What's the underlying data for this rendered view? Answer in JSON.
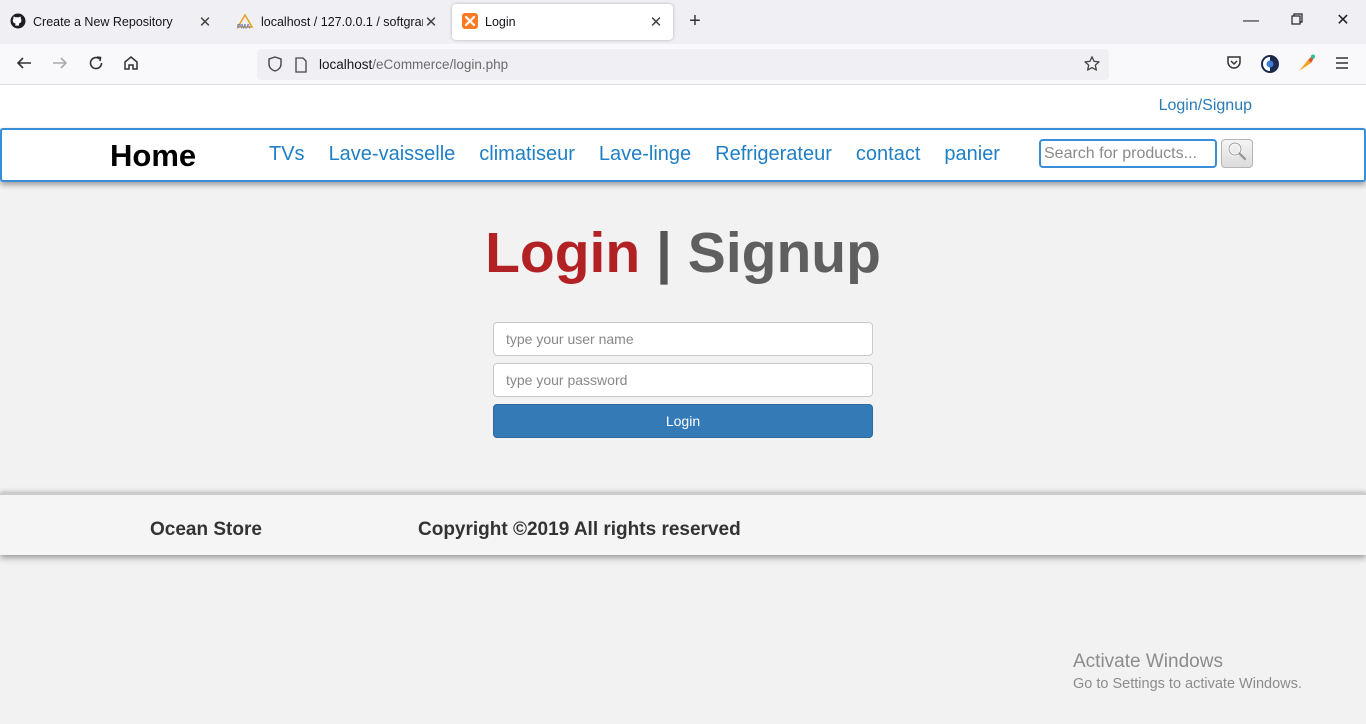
{
  "browser": {
    "tabs": [
      {
        "title": "Create a New Repository",
        "icon": "github-icon",
        "active": false
      },
      {
        "title": "localhost / 127.0.0.1 / softgram",
        "icon": "phpmyadmin-icon",
        "active": false
      },
      {
        "title": "Login",
        "icon": "xampp-icon",
        "active": true
      }
    ],
    "url_host": "localhost",
    "url_path": "/eCommerce/login.php"
  },
  "header": {
    "login_signup_link": "Login/Signup"
  },
  "nav": {
    "brand": "Home",
    "items": [
      "TVs",
      "Lave-vaisselle",
      "climatiseur",
      "Lave-linge",
      "Refrigerateur",
      "contact",
      "panier"
    ],
    "search_placeholder": "Search for products..."
  },
  "login": {
    "title_login": "Login",
    "title_sep": " | ",
    "title_signup": "Signup",
    "username_placeholder": "type your user name",
    "password_placeholder": "type your password",
    "submit_label": "Login"
  },
  "footer": {
    "brand": "Ocean Store",
    "copyright": "Copyright ©2019 All rights reserved"
  },
  "watermark": {
    "title": "Activate Windows",
    "subtitle": "Go to Settings to activate Windows."
  },
  "colors": {
    "accent_blue": "#337ab7",
    "link_blue": "#1f7fc4",
    "login_red": "#b22124"
  }
}
